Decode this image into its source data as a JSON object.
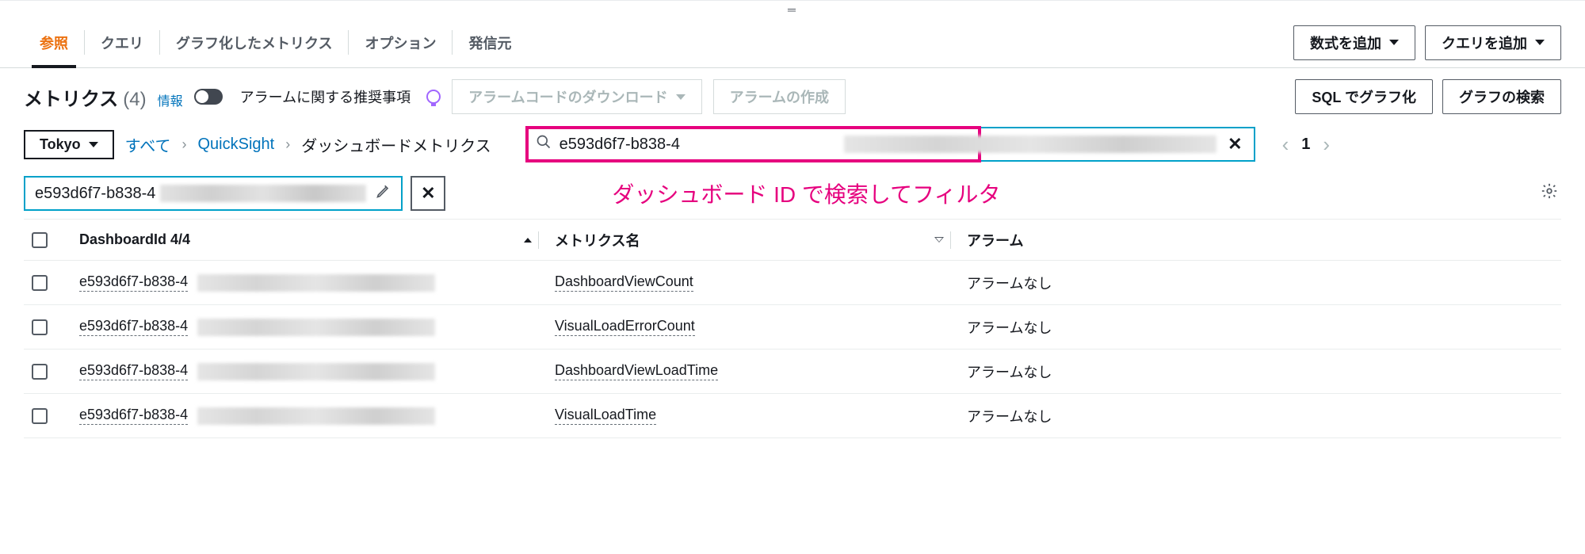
{
  "tabs": {
    "browse": "参照",
    "query": "クエリ",
    "graphed": "グラフ化したメトリクス",
    "options": "オプション",
    "source": "発信元"
  },
  "actions": {
    "add_math": "数式を追加",
    "add_query": "クエリを追加",
    "download_alarm_code": "アラームコードのダウンロード",
    "create_alarm": "アラームの作成",
    "graph_sql": "SQL でグラフ化",
    "search_graph": "グラフの検索"
  },
  "header": {
    "title": "メトリクス",
    "count": "(4)",
    "info": "情報",
    "toggle_label": "アラームに関する推奨事項"
  },
  "breadcrumb": {
    "region": "Tokyo",
    "all": "すべて",
    "namespace": "QuickSight",
    "dimension": "ダッシュボードメトリクス"
  },
  "search": {
    "value": "e593d6f7-b838-4"
  },
  "pager": {
    "page": "1"
  },
  "chip": {
    "value": "e593d6f7-b838-4"
  },
  "annotation": "ダッシュボード ID で検索してフィルタ",
  "table": {
    "cols": {
      "dashboard_id": "DashboardId 4/4",
      "metric_name": "メトリクス名",
      "alarm": "アラーム"
    },
    "rows": [
      {
        "id_prefix": "e593d6f7-b838-4",
        "metric": "DashboardViewCount",
        "alarm": "アラームなし"
      },
      {
        "id_prefix": "e593d6f7-b838-4",
        "metric": "VisualLoadErrorCount",
        "alarm": "アラームなし"
      },
      {
        "id_prefix": "e593d6f7-b838-4",
        "metric": "DashboardViewLoadTime",
        "alarm": "アラームなし"
      },
      {
        "id_prefix": "e593d6f7-b838-4",
        "metric": "VisualLoadTime",
        "alarm": "アラームなし"
      }
    ]
  }
}
